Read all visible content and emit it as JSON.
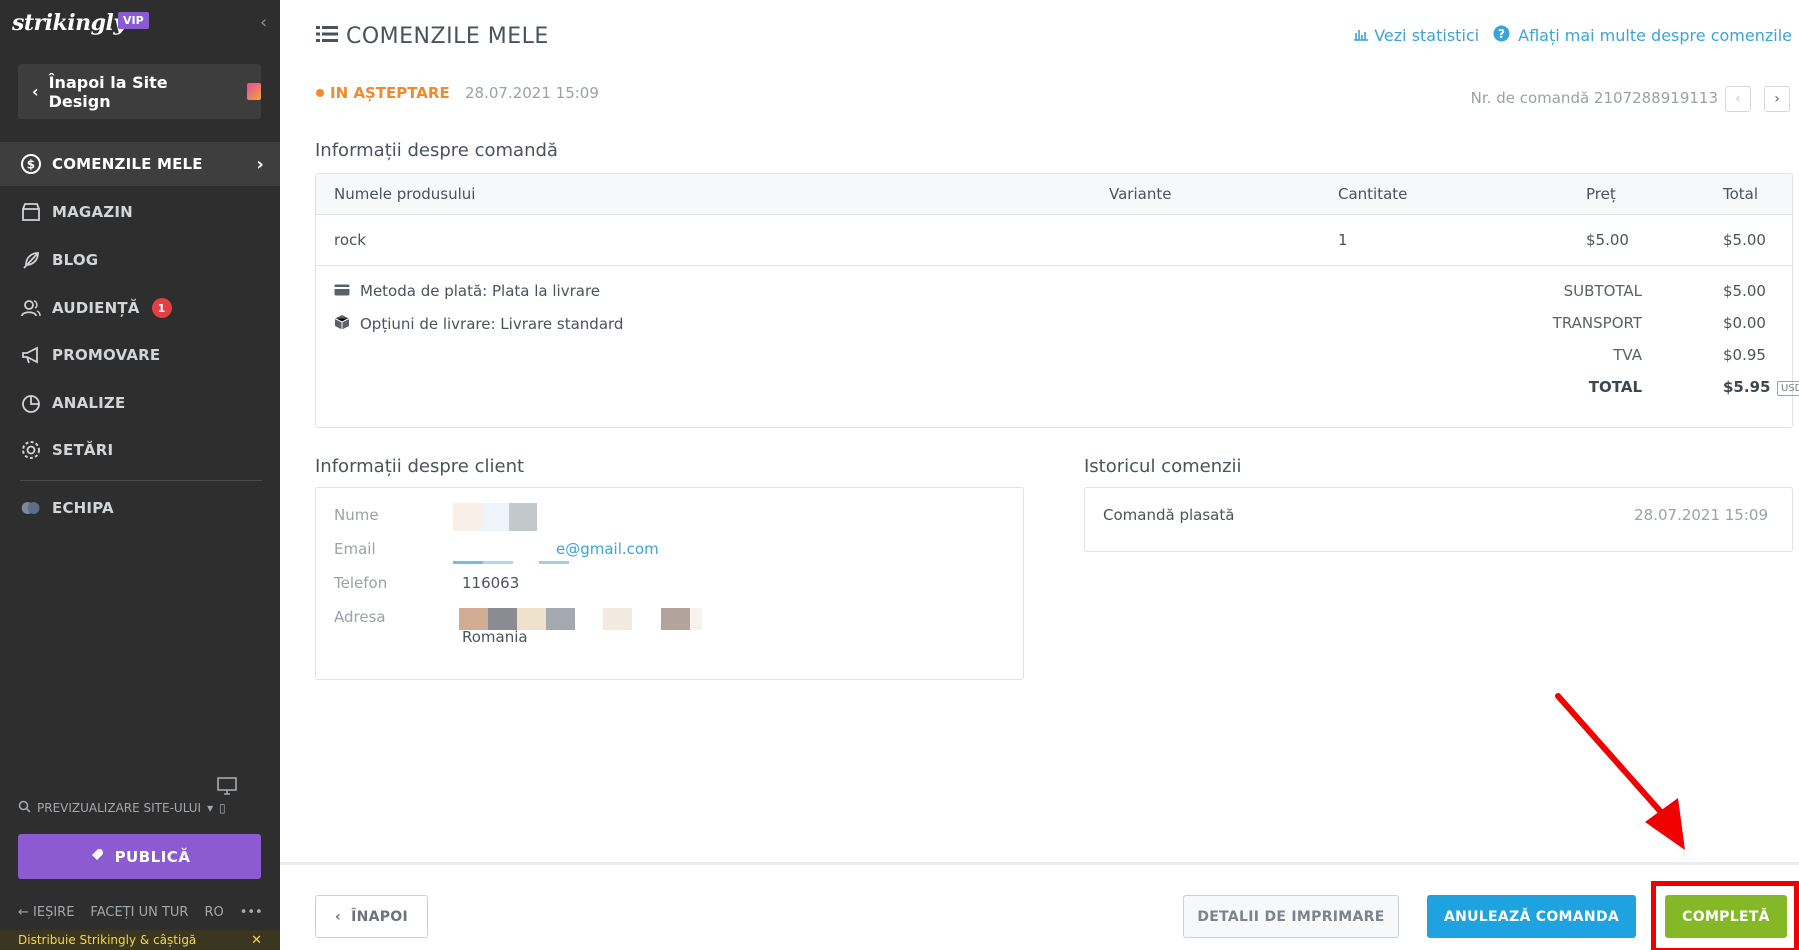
{
  "sidebar": {
    "logo": "strikingly",
    "vip": "VIP",
    "back_label": "Înapoi la Site Design",
    "items": [
      {
        "label": "COMENZILE MELE",
        "icon": "dollar-circle-icon"
      },
      {
        "label": "MAGAZIN",
        "icon": "store-icon"
      },
      {
        "label": "BLOG",
        "icon": "feather-icon"
      },
      {
        "label": "AUDIENȚĂ",
        "icon": "people-icon",
        "badge": "1"
      },
      {
        "label": "PROMOVARE",
        "icon": "megaphone-icon"
      },
      {
        "label": "ANALIZE",
        "icon": "pie-chart-icon"
      },
      {
        "label": "SETĂRI",
        "icon": "gear-icon"
      },
      {
        "label": "ECHIPA",
        "icon": "team-avatar-icon"
      }
    ],
    "preview_label": "PREVIZUALIZARE SITE-ULUI",
    "publish_label": "PUBLICĂ",
    "footer": {
      "exit": "IEȘIRE",
      "tour": "FACEȚI UN TUR",
      "lang": "RO",
      "more": "•••"
    },
    "promo": "Distribuie Strikingly & câștigă"
  },
  "header": {
    "title": "COMENZILE MELE",
    "stats_link": "Vezi statistici",
    "help_link": "Aflați mai multe despre comenzile"
  },
  "order": {
    "status": "IN AȘTEPTARE",
    "date": "28.07.2021 15:09",
    "number_label": "Nr. de comandă 2107288919113",
    "section_title": "Informații despre comandă",
    "columns": [
      "Numele produsului",
      "Variante",
      "Cantitate",
      "Preț",
      "Total"
    ],
    "rows": [
      {
        "name": "rock",
        "variant": "",
        "qty": "1",
        "price": "$5.00",
        "total": "$5.00"
      }
    ],
    "payment": "Metoda de plată: Plata la livrare",
    "shipping": "Opțiuni de livrare: Livrare standard",
    "summary": [
      {
        "label": "SUBTOTAL",
        "value": "$5.00"
      },
      {
        "label": "TRANSPORT",
        "value": "$0.00"
      },
      {
        "label": "TVA",
        "value": "$0.95"
      },
      {
        "label": "TOTAL",
        "value": "$5.95"
      }
    ],
    "currency": "USD"
  },
  "client": {
    "section_title": "Informații despre client",
    "name_label": "Nume",
    "email_label": "Email",
    "email_value": "e@gmail.com",
    "phone_label": "Telefon",
    "phone_value": "116063",
    "address_label": "Adresa",
    "country": "Romania"
  },
  "history": {
    "section_title": "Istoricul comenzii",
    "event": "Comandă plasată",
    "date": "28.07.2021 15:09"
  },
  "actions": {
    "back": "ÎNAPOI",
    "print": "DETALII DE IMPRIMARE",
    "cancel": "ANULEAZĂ COMANDA",
    "complete": "COMPLETĂ"
  },
  "colors": {
    "sidebar_bg": "#2e2e2e",
    "accent_purple": "#8c5ad1",
    "status_orange": "#f28a2d",
    "link_blue": "#3aa4d7",
    "cancel_blue": "#1fa3e0",
    "complete_green": "#85b827",
    "annotation_red": "#f00000"
  }
}
